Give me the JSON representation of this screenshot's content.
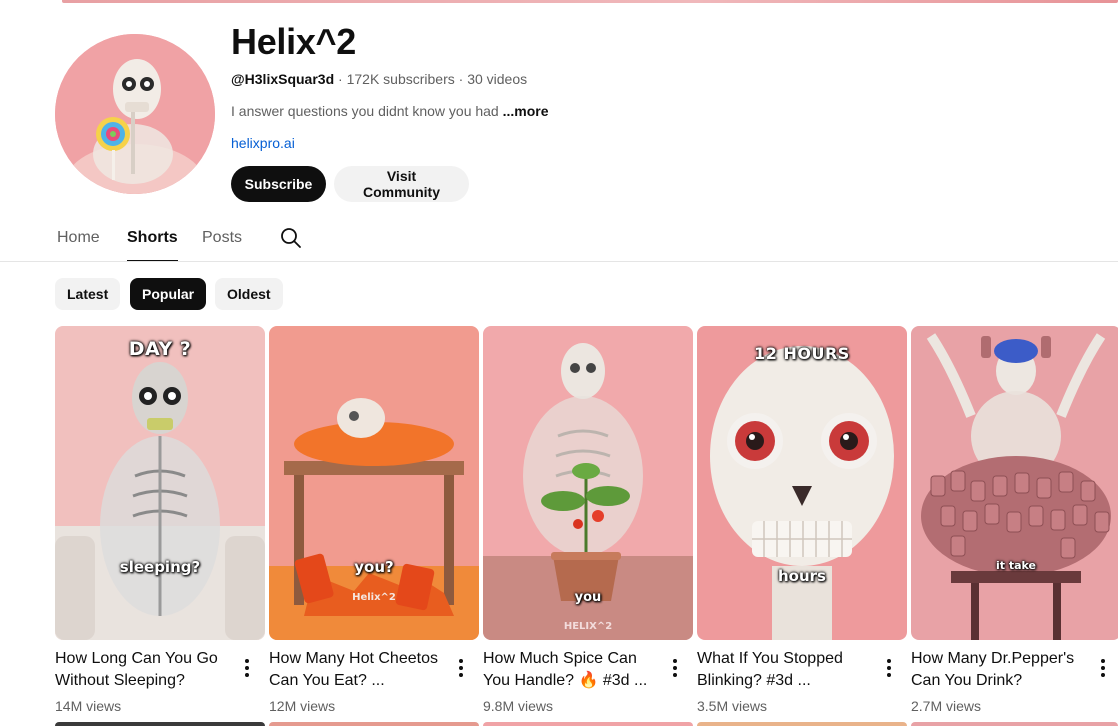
{
  "channel": {
    "name": "Helix^2",
    "handle": "@H3lixSquar3d",
    "stats": " · 172K subscribers · 30 videos",
    "description": "I answer questions you didnt know you had ",
    "more_label": "...more",
    "link": "helixpro.ai"
  },
  "buttons": {
    "subscribe": "Subscribe",
    "community": "Visit Community"
  },
  "tabs": [
    {
      "label": "Home",
      "active": false
    },
    {
      "label": "Shorts",
      "active": true
    },
    {
      "label": "Posts",
      "active": false
    }
  ],
  "tab_icons": {
    "search": "search-icon"
  },
  "filters": [
    {
      "label": "Latest",
      "active": false
    },
    {
      "label": "Popular",
      "active": true
    },
    {
      "label": "Oldest",
      "active": false
    }
  ],
  "shorts": [
    {
      "title": "How Long Can You Go Without Sleeping?",
      "views": "14M views",
      "caption_top": "DAY ?",
      "caption_mid": "sleeping?"
    },
    {
      "title": "How Many Hot Cheetos Can You Eat? ...",
      "views": "12M views",
      "caption_top": "",
      "caption_mid": "you?",
      "watermark": "Helix^2"
    },
    {
      "title": "How Much Spice Can You Handle? 🔥 #3d ...",
      "views": "9.8M views",
      "caption_top": "",
      "caption_mid": "you",
      "watermark": "HELIX^2"
    },
    {
      "title": "What If You Stopped Blinking? #3d ...",
      "views": "3.5M views",
      "caption_top": "12 HOURS",
      "caption_mid": "hours"
    },
    {
      "title": "How Many Dr.Pepper's Can You Drink?",
      "views": "2.7M views",
      "caption_top": "",
      "caption_mid": "it take"
    }
  ],
  "icons": {
    "menu": "more-vert-icon"
  },
  "colors": {
    "accent": "#0f0f0f",
    "link": "#065fd4",
    "muted": "#606060",
    "chip_bg": "#f2f2f2",
    "thumb_pink": "#f2a7aa"
  }
}
